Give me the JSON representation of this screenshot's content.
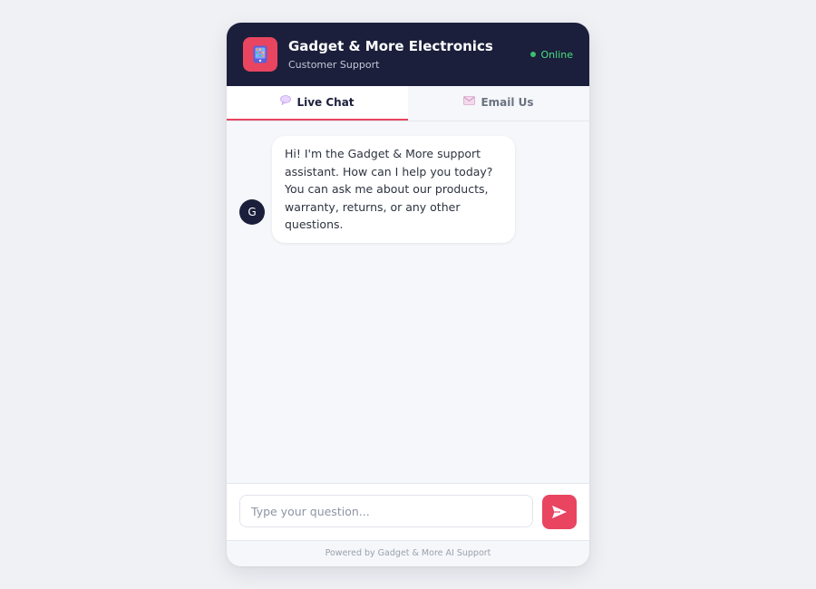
{
  "header": {
    "title": "Gadget & More Electronics",
    "subtitle": "Customer Support",
    "status": "Online",
    "logo_icon": "phone-icon"
  },
  "tabs": [
    {
      "label": "Live Chat",
      "icon": "speech-bubble-icon",
      "active": true
    },
    {
      "label": "Email Us",
      "icon": "envelope-icon",
      "active": false
    }
  ],
  "messages": [
    {
      "sender": "bot",
      "avatar_letter": "G",
      "text": "Hi! I'm the Gadget & More support assistant. How can I help you today? You can ask me about our products, warranty, returns, or any other questions."
    }
  ],
  "composer": {
    "placeholder": "Type your question...",
    "value": "",
    "send_icon": "send-icon"
  },
  "footer": {
    "text": "Powered by Gadget & More AI Support"
  },
  "colors": {
    "header_bg": "#1b1f3b",
    "accent": "#e94560",
    "online": "#4ade80"
  }
}
